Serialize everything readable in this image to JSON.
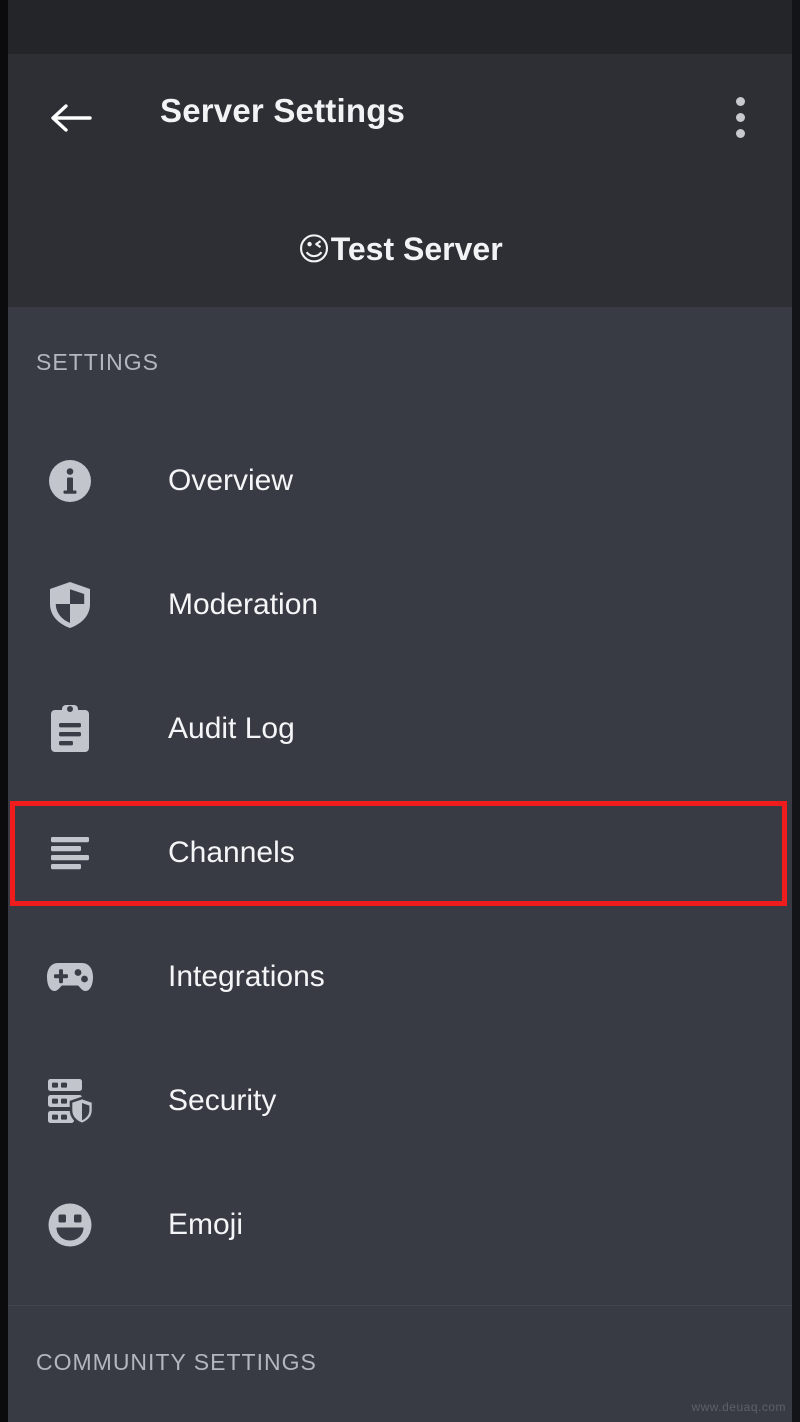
{
  "header": {
    "back_icon": "arrow-left-icon",
    "title": "Server Settings",
    "overflow_icon": "more-vertical-icon",
    "server_emoji": "😉",
    "server_name": "Test Server"
  },
  "sections": {
    "settings_label": "SETTINGS",
    "community_label": "COMMUNITY SETTINGS"
  },
  "nav_items": [
    {
      "id": "overview",
      "label": "Overview",
      "icon": "info-circle-icon"
    },
    {
      "id": "moderation",
      "label": "Moderation",
      "icon": "shield-icon"
    },
    {
      "id": "auditlog",
      "label": "Audit Log",
      "icon": "clipboard-icon"
    },
    {
      "id": "channels",
      "label": "Channels",
      "icon": "channels-list-icon"
    },
    {
      "id": "integrations",
      "label": "Integrations",
      "icon": "gamepad-icon"
    },
    {
      "id": "security",
      "label": "Security",
      "icon": "server-shield-icon"
    },
    {
      "id": "emoji",
      "label": "Emoji",
      "icon": "smiley-icon"
    }
  ],
  "annotation": {
    "highlight_target": "Channels",
    "color": "#ee1c1c"
  },
  "watermark": "www.deuaq.com",
  "colors": {
    "status_bar": "#242529",
    "header_bg": "#2d2f34",
    "body_bg": "#383b44",
    "icon_gray": "#c2c5cb",
    "text_primary": "#f4f5f7",
    "text_muted": "#b3b6bd",
    "highlight_red": "#ee1c1c"
  }
}
